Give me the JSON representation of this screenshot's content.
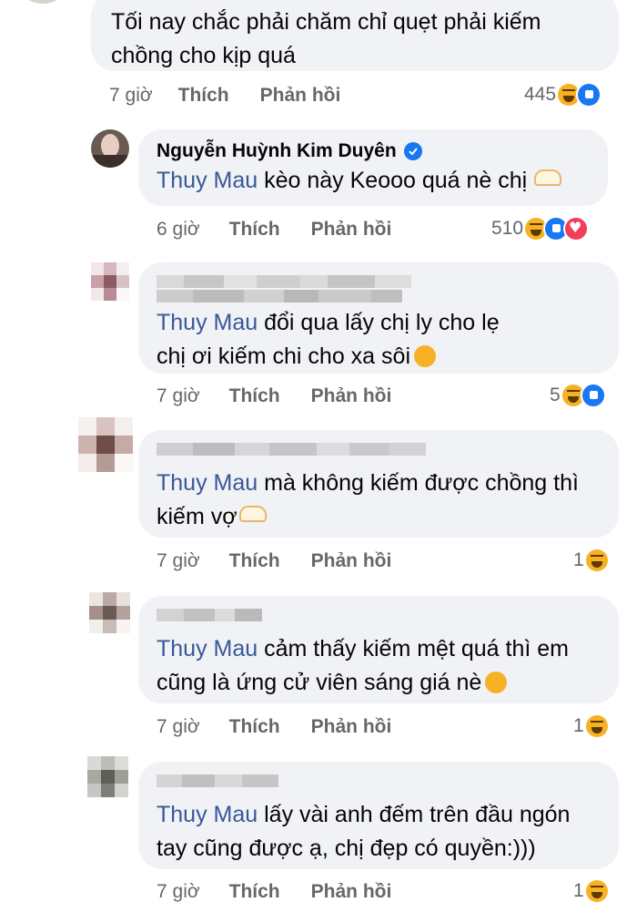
{
  "comments": [
    {
      "text": "Tối nay chắc phải chăm chỉ quẹt phải kiếm chồng cho kịp quá",
      "time": "7 giờ",
      "like": "Thích",
      "reply": "Phản hồi",
      "reaction_count": "445",
      "reactions": [
        "haha",
        "like"
      ]
    },
    {
      "author": "Nguyễn Huỳnh Kim Duyên",
      "mention": "Thuy Mau",
      "text": "kèo này Keooo quá nè chị",
      "time": "6 giờ",
      "like": "Thích",
      "reply": "Phản hồi",
      "reaction_count": "510",
      "reactions": [
        "haha",
        "like",
        "love"
      ]
    },
    {
      "mention": "Thuy Mau",
      "text": "đổi qua lấy chị ly cho lẹ chị ơi kiếm chi cho xa sôi",
      "time": "7 giờ",
      "like": "Thích",
      "reply": "Phản hồi",
      "reaction_count": "5",
      "reactions": [
        "haha",
        "like"
      ]
    },
    {
      "mention": "Thuy Mau",
      "text": "mà  không kiếm được chồng thì kiếm vợ",
      "time": "7 giờ",
      "like": "Thích",
      "reply": "Phản hồi",
      "reaction_count": "1",
      "reactions": [
        "haha"
      ]
    },
    {
      "mention": "Thuy Mau",
      "text": "cảm thấy kiếm mệt quá thì em cũng là ứng cử viên sáng giá nè",
      "time": "7 giờ",
      "like": "Thích",
      "reply": "Phản hồi",
      "reaction_count": "1",
      "reactions": [
        "haha"
      ]
    },
    {
      "mention": "Thuy Mau",
      "text": "lấy vài anh đếm trên đầu ngón tay cũng được ạ, chị đẹp có quyền:)))",
      "time": "7 giờ",
      "like": "Thích",
      "reply": "Phản hồi",
      "reaction_count": "1",
      "reactions": [
        "haha"
      ]
    }
  ],
  "colors": {
    "bubble": "#f0f2f5",
    "mention": "#385898",
    "meta": "#65676b",
    "like_blue": "#1877f2",
    "haha_yellow": "#f7b125",
    "love_red": "#f33e58"
  },
  "icons": [
    "verified-badge-icon",
    "haha-reaction-icon",
    "like-reaction-icon",
    "love-reaction-icon",
    "hand-heart-emoji",
    "laughing-emoji",
    "smiling-emoji"
  ]
}
